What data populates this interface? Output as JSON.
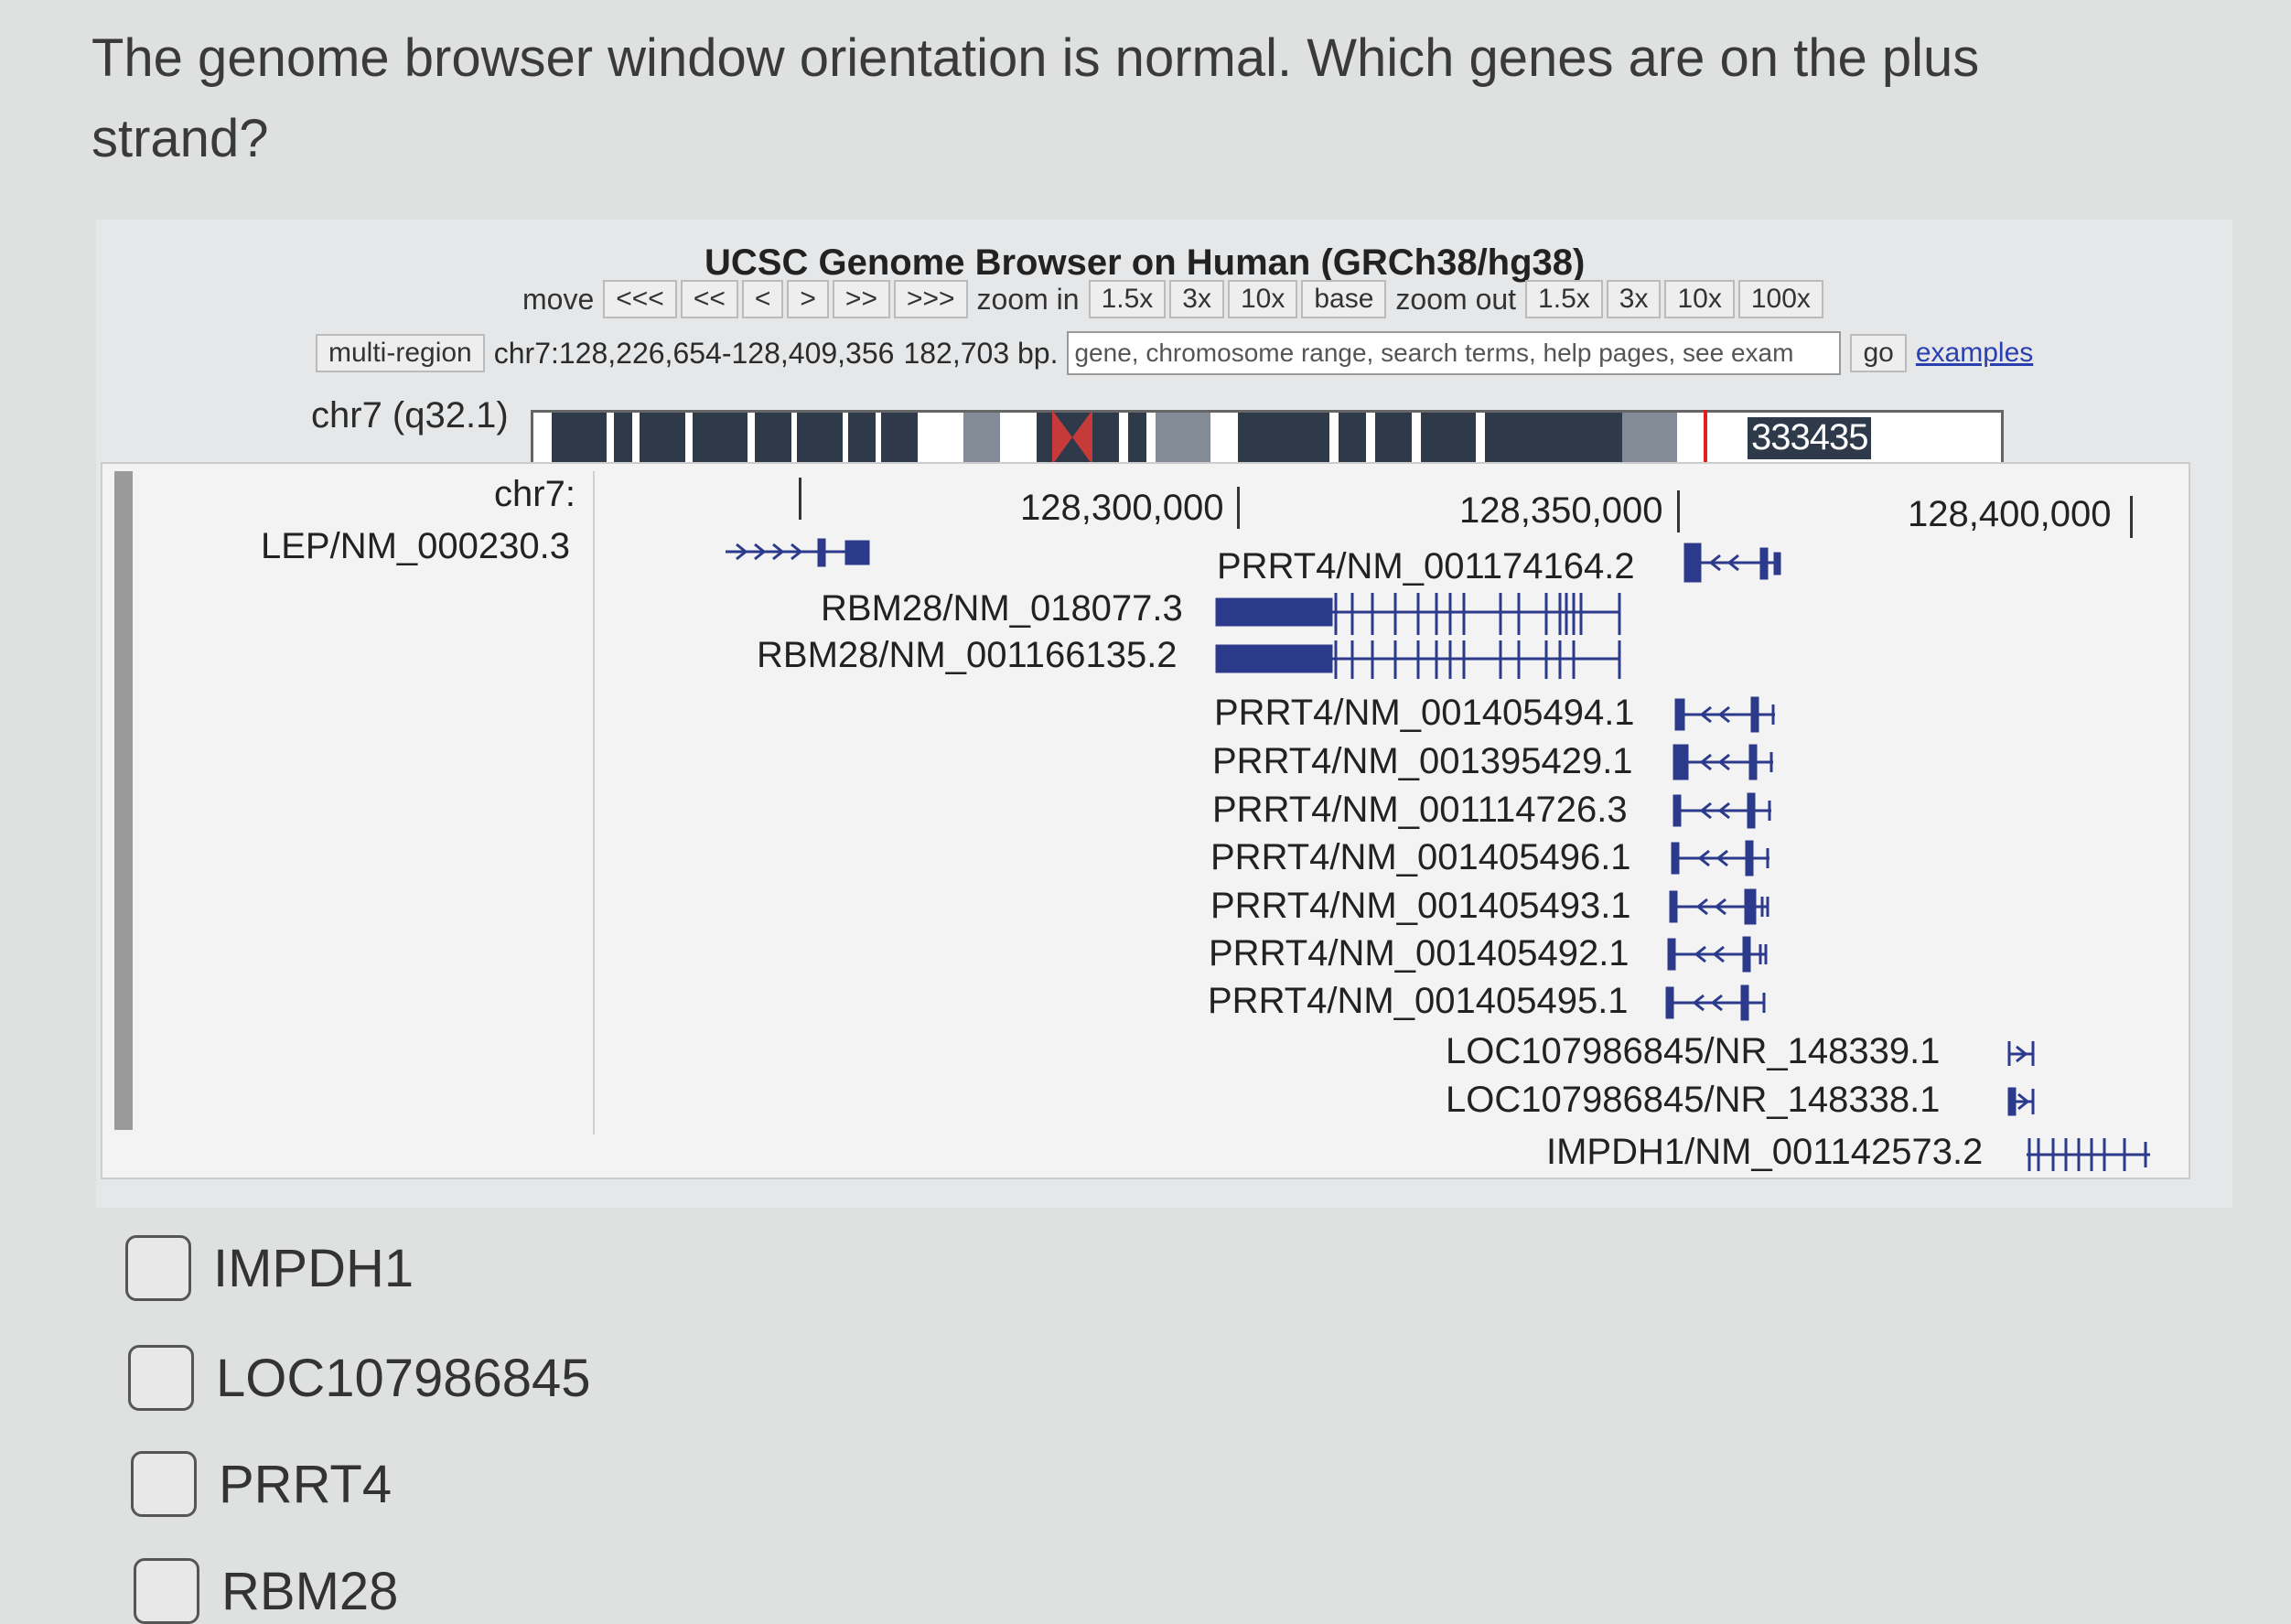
{
  "question": "The genome browser window orientation is normal. Which genes are on the plus strand?",
  "browser": {
    "title": "UCSC Genome Browser on Human (GRCh38/hg38)",
    "move_label": "move",
    "move_buttons": [
      "<<<",
      "<<",
      "<",
      ">",
      ">>",
      ">>>"
    ],
    "zoom_in_label": "zoom in",
    "zoom_in_buttons": [
      "1.5x",
      "3x",
      "10x",
      "base"
    ],
    "zoom_out_label": "zoom out",
    "zoom_out_buttons": [
      "1.5x",
      "3x",
      "10x",
      "100x"
    ],
    "multi_region": "multi-region",
    "position": "chr7:128,226,654-128,409,356",
    "size": "182,703 bp.",
    "search_placeholder": "gene, chromosome range, search terms, help pages, see exam",
    "go": "go",
    "examples": "examples",
    "chrom_band": "chr7 (q32.1)",
    "band_label": "333435",
    "ruler_chrom": "chr7:",
    "ruler_ticks": [
      "128,300,000",
      "128,350,000",
      "128,400,000"
    ]
  },
  "genes": [
    {
      "label": "LEP/NM_000230.3",
      "strand": "+"
    },
    {
      "label": "PRRT4/NM_001174164.2",
      "strand": "-"
    },
    {
      "label": "RBM28/NM_018077.3",
      "strand": "-"
    },
    {
      "label": "RBM28/NM_001166135.2",
      "strand": "-"
    },
    {
      "label": "PRRT4/NM_001405494.1",
      "strand": "-"
    },
    {
      "label": "PRRT4/NM_001395429.1",
      "strand": "-"
    },
    {
      "label": "PRRT4/NM_001114726.3",
      "strand": "-"
    },
    {
      "label": "PRRT4/NM_001405496.1",
      "strand": "-"
    },
    {
      "label": "PRRT4/NM_001405493.1",
      "strand": "-"
    },
    {
      "label": "PRRT4/NM_001405492.1",
      "strand": "-"
    },
    {
      "label": "PRRT4/NM_001405495.1",
      "strand": "-"
    },
    {
      "label": "LOC107986845/NR_148339.1",
      "strand": "+"
    },
    {
      "label": "LOC107986845/NR_148338.1",
      "strand": "+"
    },
    {
      "label": "IMPDH1/NM_001142573.2",
      "strand": "-"
    }
  ],
  "options": [
    "IMPDH1",
    "LOC107986845",
    "PRRT4",
    "RBM28"
  ],
  "colors": {
    "gene": "#2c3a8c",
    "background": "#dfe1e1"
  }
}
